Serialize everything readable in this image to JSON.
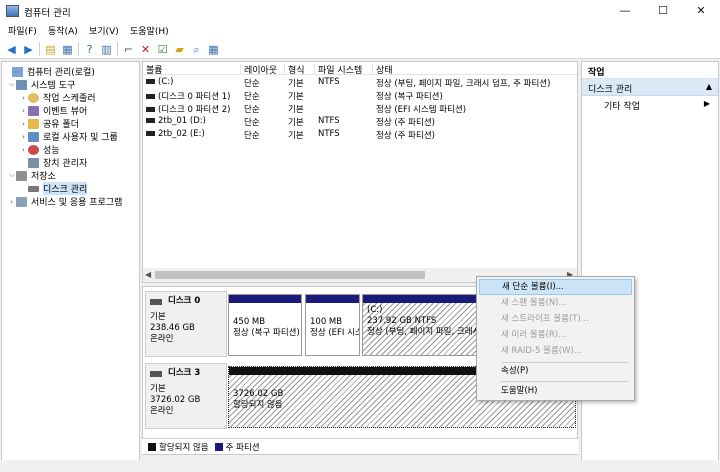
{
  "window": {
    "title": "컴퓨터 관리",
    "min": "—",
    "max": "☐",
    "close": "✕"
  },
  "menu": [
    "파일(F)",
    "동작(A)",
    "보기(V)",
    "도움말(H)"
  ],
  "tree": {
    "root": "컴퓨터 관리(로컬)",
    "system_tools": "시스템 도구",
    "task_scheduler": "작업 스케줄러",
    "event_viewer": "이벤트 뷰어",
    "shared_folders": "공유 폴더",
    "local_users": "로컬 사용자 및 그룹",
    "performance": "성능",
    "device_manager": "장치 관리자",
    "storage": "저장소",
    "disk_management": "디스크 관리",
    "services": "서비스 및 응용 프로그램"
  },
  "volumes": {
    "columns": [
      "볼륨",
      "레이아웃",
      "형식",
      "파일 시스템",
      "상태"
    ],
    "rows": [
      [
        "(C:)",
        "단순",
        "기본",
        "NTFS",
        "정상 (부팅, 페이지 파일, 크래시 덤프, 주 파티션)"
      ],
      [
        "(디스크 0 파티션 1)",
        "단순",
        "기본",
        "",
        "정상 (복구 파티션)"
      ],
      [
        "(디스크 0 파티션 2)",
        "단순",
        "기본",
        "",
        "정상 (EFI 시스템 파티션)"
      ],
      [
        "2tb_01 (D:)",
        "단순",
        "기본",
        "NTFS",
        "정상 (주 파티션)"
      ],
      [
        "2tb_02 (E:)",
        "단순",
        "기본",
        "NTFS",
        "정상 (주 파티션)"
      ]
    ]
  },
  "disks": [
    {
      "name": "디스크 0",
      "type": "기본",
      "size": "238.46 GB",
      "status": "온라인",
      "partitions": [
        {
          "title": "",
          "size": "450 MB",
          "status": "정상 (복구 파티션)"
        },
        {
          "title": "",
          "size": "100 MB",
          "status": "정상 (EFI 시스"
        },
        {
          "title": "(C:)",
          "size": "237.92 GB NTFS",
          "status": "정상 (부팅, 페이지 파일, 크래시"
        }
      ]
    },
    {
      "name": "디스크 3",
      "type": "기본",
      "size": "3726.02 GB",
      "status": "온라인",
      "partitions": [
        {
          "title": "",
          "size": "3726.02 GB",
          "status": "할당되지 않음"
        }
      ]
    }
  ],
  "legend": {
    "unallocated": "할당되지 않음",
    "primary": "주 파티션",
    "unallocated_color": "#111111",
    "primary_color": "#1a1a7a"
  },
  "actions": {
    "header": "작업",
    "section": "디스크 관리",
    "more": "기타 작업"
  },
  "context_menu": [
    {
      "label": "새 단순 볼륨(I)...",
      "enabled": true
    },
    {
      "label": "새 스팬 볼륨(N)...",
      "enabled": false
    },
    {
      "label": "새 스트라이프 볼륨(T)...",
      "enabled": false
    },
    {
      "label": "새 미러 볼륨(R)...",
      "enabled": false
    },
    {
      "label": "새 RAID-5 볼륨(W)...",
      "enabled": false
    },
    {
      "label": "속성(P)",
      "enabled": true
    },
    {
      "label": "도움말(H)",
      "enabled": true
    }
  ]
}
